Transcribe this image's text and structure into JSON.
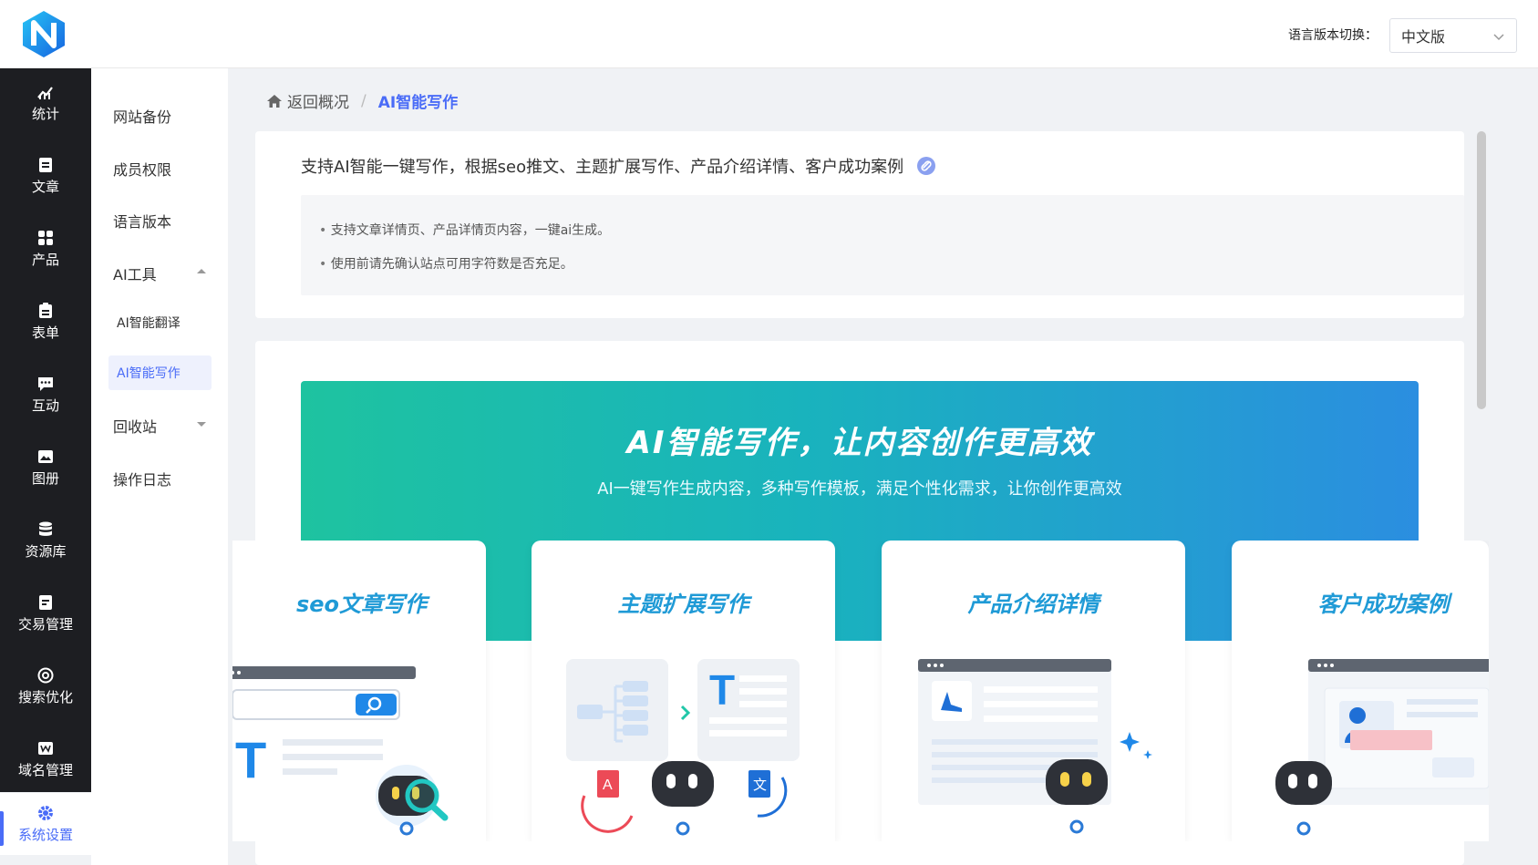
{
  "header": {
    "lang_label": "语言版本切换：",
    "lang_value": "中文版"
  },
  "leftnav": {
    "items": [
      {
        "label": "统计",
        "icon": "chart-icon"
      },
      {
        "label": "文章",
        "icon": "article-icon"
      },
      {
        "label": "产品",
        "icon": "grid-icon"
      },
      {
        "label": "表单",
        "icon": "clipboard-icon"
      },
      {
        "label": "互动",
        "icon": "chat-icon"
      },
      {
        "label": "图册",
        "icon": "gallery-icon"
      },
      {
        "label": "资源库",
        "icon": "database-icon"
      },
      {
        "label": "交易管理",
        "icon": "order-icon"
      },
      {
        "label": "搜索优化",
        "icon": "target-icon"
      },
      {
        "label": "域名管理",
        "icon": "domain-icon"
      }
    ],
    "active": {
      "label": "系统设置",
      "icon": "gear-icon"
    }
  },
  "subnav": {
    "items": [
      {
        "label": "网站备份"
      },
      {
        "label": "成员权限"
      },
      {
        "label": "语言版本"
      },
      {
        "label": "AI工具"
      },
      {
        "label": "AI智能翻译"
      },
      {
        "label": "AI智能写作"
      },
      {
        "label": "回收站"
      },
      {
        "label": "操作日志"
      }
    ]
  },
  "breadcrumb": {
    "home": "返回概况",
    "current": "AI智能写作"
  },
  "info": {
    "title": "支持AI智能一键写作，根据seo推文、主题扩展写作、产品介绍详情、客户成功案例",
    "bullets": [
      "支持文章详情页、产品详情页内容，一键ai生成。",
      "使用前请先确认站点可用字符数是否充足。"
    ]
  },
  "banner": {
    "title": "AI智能写作，让内容创作更高效",
    "subtitle": "AI一键写作生成内容，多种写作模板，满足个性化需求，让你创作更高效"
  },
  "features": [
    {
      "title": "seo文章写作"
    },
    {
      "title": "主题扩展写作"
    },
    {
      "title": "产品介绍详情"
    },
    {
      "title": "客户成功案例"
    }
  ],
  "colors": {
    "accent": "#4a6cf7",
    "nav_bg": "#1d1e22",
    "banner_start": "#1ec3a0",
    "banner_end": "#2b8ee0",
    "feature_title": "#1f9ad6"
  }
}
